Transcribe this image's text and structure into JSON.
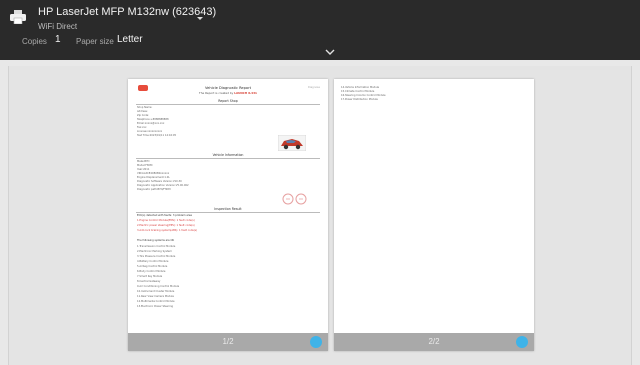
{
  "header": {
    "printer_name": "HP LaserJet MFP M132nw (623643)",
    "connection": "WiFi Direct",
    "copies_label": "Copies",
    "copies_value": "1",
    "paper_label": "Paper size",
    "paper_value": "Letter"
  },
  "colors": {
    "header_bg": "#2a2a2a",
    "accent": "#3fb3e8",
    "footer_bg": "#a9a9a9"
  },
  "pages": [
    {
      "footer_label": "1/2",
      "doc": {
        "corner": "Diagnose",
        "title": "Vehicle Diagnostic Report",
        "subtitle": "The Report is created by",
        "brand": "LAUNCH X-431",
        "shop_heading": "Report Shop",
        "shop_lines": [
          "Shop Name:",
          "Address:",
          "Zip Code:",
          "Telephone:+8888888888",
          "Email:xxxxx@xxx.xxx",
          "Fax:xxx",
          "License:xxxxxxxxxx",
          "Test Time:2023/01/11 14:16:05"
        ],
        "vehicle_heading": "Vehicle Information",
        "vehicle_lines": [
          "Make:BYD",
          "Model:F3DM",
          "Year:2011",
          "VIN:LGXCE4CB0B0xxxxxx",
          "Engine Displacement:1.0L",
          "Diagnostic Software Version:V10.30",
          "Diagnostic Application Version:V5.00.002",
          "Diagnostic path:BYD/F3DM"
        ],
        "result_heading": "Inspection Result",
        "result_intro": "ECU(s) detected with faults: 3 problem area",
        "fault_lines": [
          "1.Engine Control Module(EMS): 1 fault code(s)",
          "2.Electric power steering(EPS): 1 fault code(s)",
          "3.Anti-lock braking system(ABS): 1 fault code(s)"
        ],
        "ok_intro": "The following systems are OK",
        "ok_lines": [
          "1.Transmission Control Module",
          "2.Electronic Parking System",
          "3.Tire Pressure Control Module",
          "4.Battery Control Module",
          "5.Airbag Control Module",
          "6.Body Control Module",
          "7.Smart Key Module",
          "8.Central Gateway",
          "9.Air Conditioning Control Module",
          "10.Instrument Cluster Module",
          "11.Rear View Camera Module",
          "12.Multimedia Control Module",
          "13.Electronic Power Steering"
        ]
      }
    },
    {
      "footer_label": "2/2",
      "lines": [
        "14.Vehicle Information Module",
        "15.Climate Control Module",
        "16.Steering Column Control Module",
        "17.Power Distribution Module"
      ]
    }
  ]
}
